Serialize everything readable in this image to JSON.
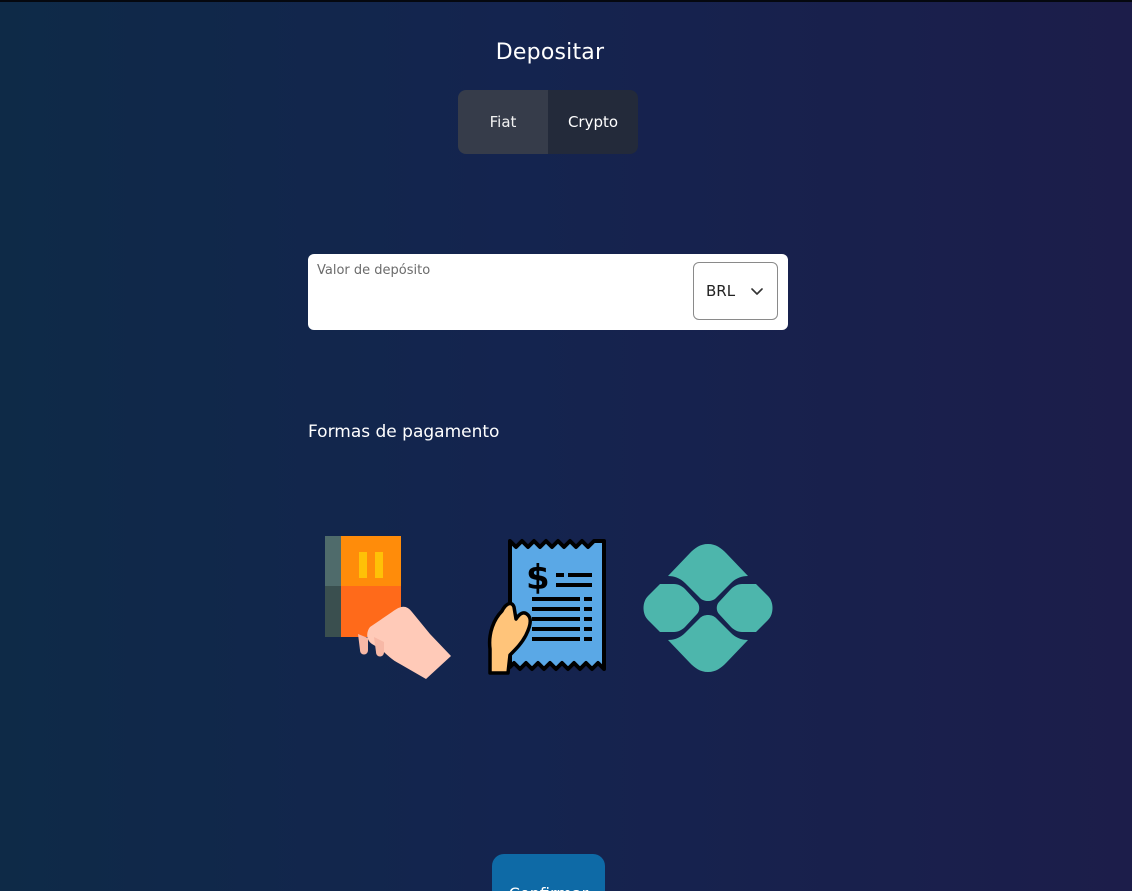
{
  "page": {
    "title": "Depositar"
  },
  "tabs": [
    {
      "label": "Fiat",
      "active": true
    },
    {
      "label": "Crypto",
      "active": false
    }
  ],
  "deposit": {
    "label": "Valor de depósito",
    "value": "",
    "currency": "BRL"
  },
  "payment": {
    "title": "Formas de pagamento",
    "methods": [
      {
        "icon": "credit-card-hand-icon"
      },
      {
        "icon": "boleto-receipt-icon"
      },
      {
        "icon": "pix-icon"
      }
    ]
  },
  "actions": {
    "confirm_label": "Confirmar"
  },
  "colors": {
    "confirm_button": "#0e6aa6",
    "tab_active": "#363c4a",
    "tab_inactive": "#232a3a",
    "pix": "#4db6ac"
  }
}
